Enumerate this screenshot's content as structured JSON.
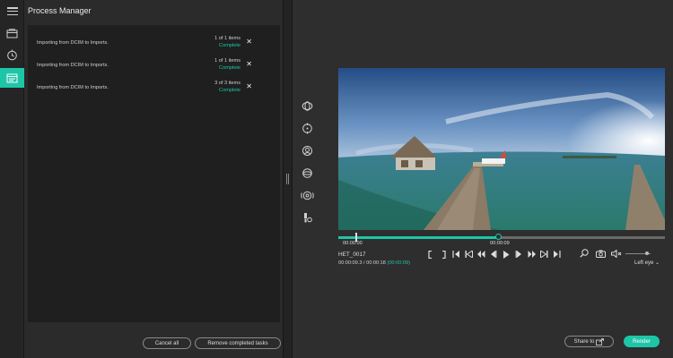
{
  "app": {
    "panel_title": "Process Manager"
  },
  "rail": {
    "icons": [
      "menu-icon",
      "media-library-icon",
      "history-icon",
      "process-manager-icon"
    ],
    "active_icon": "process-manager-icon"
  },
  "process_manager": {
    "tasks": [
      {
        "message": "Importing from DCIM to Imports.",
        "count": "1 of 1 items",
        "status": "Complete"
      },
      {
        "message": "Importing from DCIM to Imports.",
        "count": "1 of 1 items",
        "status": "Complete"
      },
      {
        "message": "Importing from DCIM to Imports.",
        "count": "3 of 3 items",
        "status": "Complete"
      }
    ],
    "cancel_all_label": "Cancel all",
    "remove_completed_label": "Remove completed tasks"
  },
  "tools": [
    "stabilize-icon",
    "target-icon",
    "face-icon",
    "rotate-icon",
    "audio-spatial-icon",
    "light-bulb-icon"
  ],
  "player": {
    "in_point": "00:00:00",
    "out_point": "00:00:09",
    "progress": 0.49,
    "clip_name": "HET_0017",
    "time_current": "00:00:09.3 / 00:00:18",
    "time_selection": "(00:00:09)",
    "eye_label": "Left eye",
    "volume": 0.86
  },
  "transport": [
    "in-bracket-icon",
    "out-bracket-icon",
    "go-in-icon",
    "skip-start-icon",
    "step-back-icon",
    "frame-back-icon",
    "play-icon",
    "frame-forward-icon",
    "step-forward-icon",
    "skip-end-icon",
    "go-out-icon"
  ],
  "actions": {
    "share_label": "Share to",
    "render_label": "Render"
  },
  "colors": {
    "accent": "#1ec6a8",
    "panel_bg": "#2b2b2b",
    "list_bg": "#1f1f1f"
  }
}
